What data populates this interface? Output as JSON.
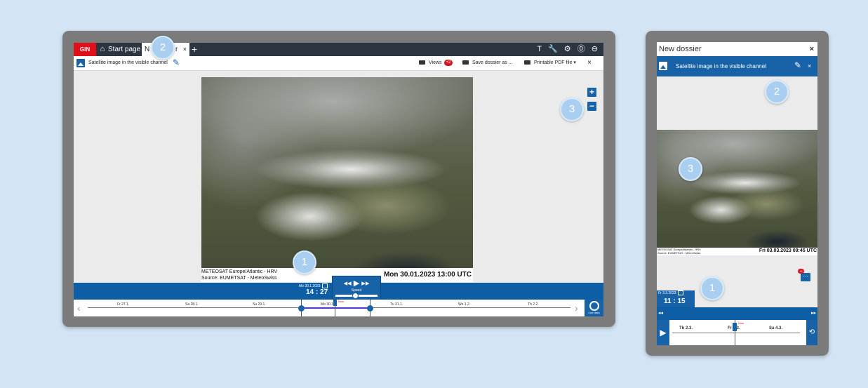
{
  "desktop": {
    "tabs": {
      "brand": "GIN",
      "start_label": "Start page",
      "active_label": "N",
      "active_label_tail": "r",
      "close": "×",
      "add": "+"
    },
    "toolbar_icons": [
      "T",
      "🔧",
      "⚙",
      "⓪",
      "⊖"
    ],
    "toolbar_icon_names": [
      "text-icon",
      "wrench-icon",
      "gear-icon",
      "help-icon",
      "logout-icon"
    ],
    "header": {
      "title": "Satellite image in the visible channel",
      "views_label": "Views",
      "views_badge": "+2",
      "save_label": "Save dossier as ...",
      "pdf_label": "Printable PDF file",
      "close": "×"
    },
    "image": {
      "source_line1": "METEOSAT Europe/Atlantic - HRV",
      "source_line2": "Source: EUMETSAT - MeteoSwiss",
      "datetime": "Mon 30.01.2023 13:00 UTC"
    },
    "zoom": {
      "in": "+",
      "out": "−"
    },
    "timeline": {
      "selected_date": "Mo 30.1.2023",
      "selected_time": "14 : 27",
      "speed_label": "Speed",
      "now_label": "Now",
      "days": [
        "Fr 27.1.",
        "Sa 28.1.",
        "Su 29.1.",
        "Mo 30.1.",
        "Tu 31.1.",
        "We 1.2.",
        "Th 2.2."
      ],
      "live_label": "Live data"
    }
  },
  "mobile": {
    "title": "New dossier",
    "close": "×",
    "header_title": "Satellite image in the visible channel",
    "image_source": "METEOSAT Europe/Atlantic - HRV",
    "image_source2": "Source: EUMETSAT - MeteoSwiss",
    "image_datetime": "Fri 03.03.2023 09:45 UTC",
    "layers_badge": "+2",
    "selected_date": "Fr 3.3.2023",
    "selected_time": "11 : 15",
    "days": [
      "Th 2.3.",
      "Fr 3.3.",
      "Sa 4.3."
    ],
    "now_label": "Now"
  },
  "callouts": [
    "1",
    "2",
    "3"
  ]
}
